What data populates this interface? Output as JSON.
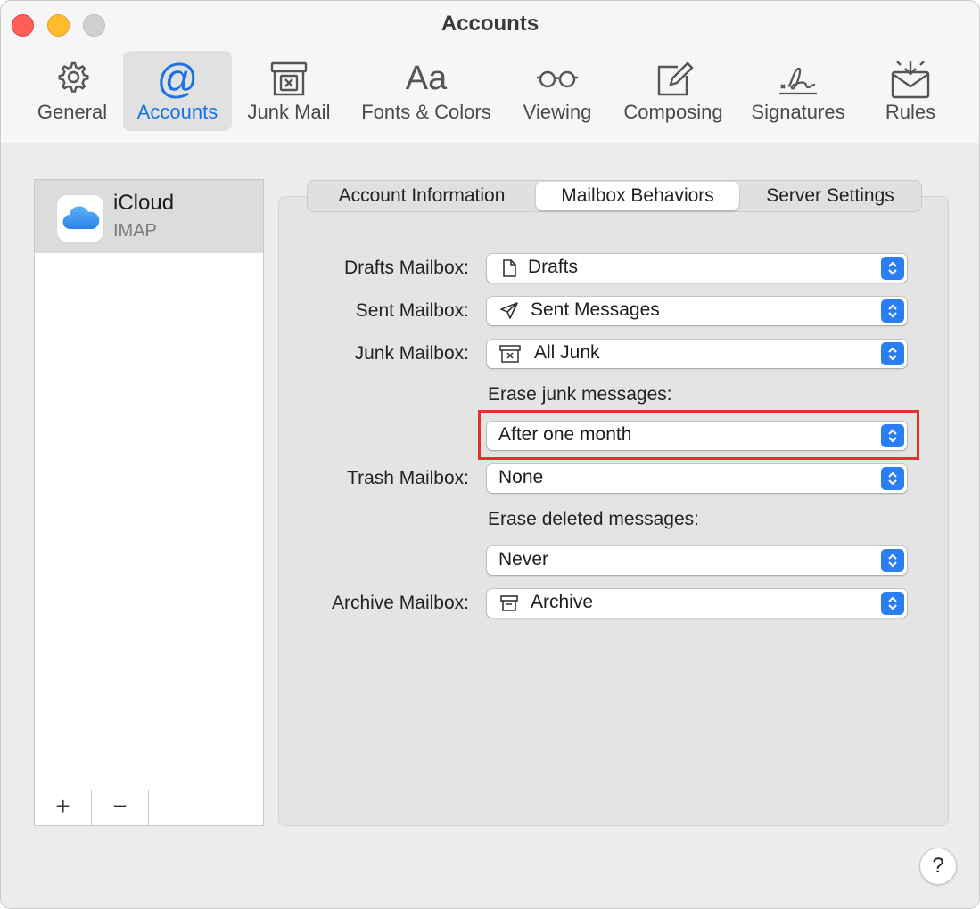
{
  "window": {
    "title": "Accounts"
  },
  "toolbar": {
    "items": [
      {
        "label": "General",
        "icon": "gear-icon"
      },
      {
        "label": "Accounts",
        "icon": "at-icon",
        "glyph": "@",
        "selected": true
      },
      {
        "label": "Junk Mail",
        "icon": "junk-bin-icon"
      },
      {
        "label": "Fonts & Colors",
        "icon": "fonts-icon",
        "glyph": "Aa"
      },
      {
        "label": "Viewing",
        "icon": "glasses-icon"
      },
      {
        "label": "Composing",
        "icon": "compose-icon"
      },
      {
        "label": "Signatures",
        "icon": "signature-icon"
      },
      {
        "label": "Rules",
        "icon": "rules-envelope-icon"
      }
    ],
    "accent_color": "#1a73e0"
  },
  "accounts": {
    "list": [
      {
        "name": "iCloud",
        "type": "IMAP",
        "icon": "icloud-icon",
        "selected": true
      }
    ],
    "add_label": "+",
    "remove_label": "−"
  },
  "tabs": {
    "items": [
      {
        "label": "Account Information"
      },
      {
        "label": "Mailbox Behaviors",
        "active": true
      },
      {
        "label": "Server Settings"
      }
    ]
  },
  "form": {
    "drafts": {
      "label": "Drafts Mailbox:",
      "value": "Drafts",
      "icon": "document-icon"
    },
    "sent": {
      "label": "Sent Mailbox:",
      "value": "Sent Messages",
      "icon": "paper-plane-icon"
    },
    "junk": {
      "label": "Junk Mailbox:",
      "value": "All Junk",
      "icon": "junk-bin-icon"
    },
    "erase_junk": {
      "label": "Erase junk messages:",
      "value": "After one month"
    },
    "trash": {
      "label": "Trash Mailbox:",
      "value": "None"
    },
    "erase_deleted": {
      "label": "Erase deleted messages:",
      "value": "Never"
    },
    "archive": {
      "label": "Archive Mailbox:",
      "value": "Archive",
      "icon": "archive-box-icon"
    }
  },
  "highlight_color": "#e0312a",
  "help": {
    "label": "?"
  }
}
